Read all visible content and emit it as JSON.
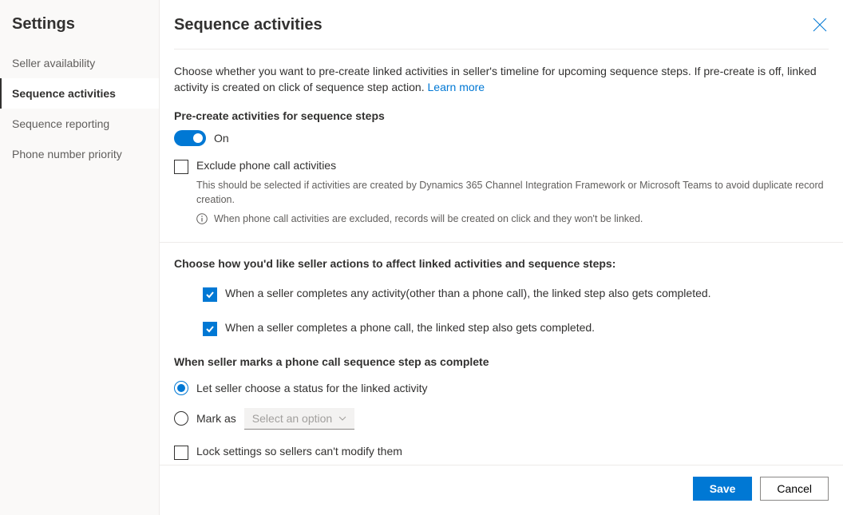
{
  "sidebar": {
    "title": "Settings",
    "items": [
      {
        "label": "Seller availability"
      },
      {
        "label": "Sequence activities"
      },
      {
        "label": "Sequence reporting"
      },
      {
        "label": "Phone number priority"
      }
    ],
    "activeIndex": 1
  },
  "header": {
    "title": "Sequence activities"
  },
  "intro": {
    "text": "Choose whether you want to pre-create linked activities in seller's timeline for upcoming sequence steps. If pre-create is off, linked activity is created on click of sequence step action. ",
    "learnMore": "Learn more"
  },
  "precreate": {
    "label": "Pre-create activities for sequence steps",
    "toggleState": "On"
  },
  "exclude": {
    "label": "Exclude phone call activities",
    "helper": "This should be selected if activities are created by Dynamics 365 Channel Integration Framework or Microsoft Teams to avoid duplicate record creation.",
    "info": "When phone call activities are excluded, records will be created on click and they won't be linked."
  },
  "affect": {
    "heading": "Choose how you'd like seller actions to affect linked activities and sequence steps:",
    "opt1": "When a seller completes any activity(other than a phone call), the linked step also gets completed.",
    "opt2": "When a seller completes a phone call, the linked step also gets completed."
  },
  "phoneComplete": {
    "heading": "When seller marks a phone call sequence step as complete",
    "radio1": "Let seller choose a status for the linked activity",
    "radio2": "Mark as",
    "selectPlaceholder": "Select an option"
  },
  "lock": {
    "label": "Lock settings so sellers can't modify them"
  },
  "footer": {
    "save": "Save",
    "cancel": "Cancel"
  }
}
